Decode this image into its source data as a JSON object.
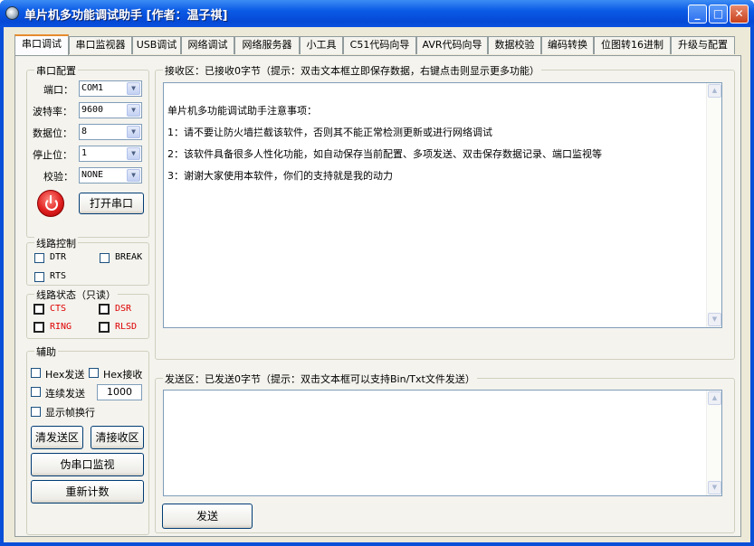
{
  "window": {
    "title": "单片机多功能调试助手 [作者：温子祺]",
    "minimize_icon": "minimize-icon",
    "maximize_icon": "maximize-icon",
    "close_icon": "close-icon"
  },
  "tabs": [
    {
      "label": "串口调试",
      "active": true
    },
    {
      "label": "串口监视器"
    },
    {
      "label": "USB调试"
    },
    {
      "label": "网络调试"
    },
    {
      "label": "网络服务器"
    },
    {
      "label": "小工具"
    },
    {
      "label": "C51代码向导"
    },
    {
      "label": "AVR代码向导"
    },
    {
      "label": "数据校验"
    },
    {
      "label": "编码转换"
    },
    {
      "label": "位图转16进制"
    },
    {
      "label": "升级与配置"
    }
  ],
  "serial_config": {
    "title": "串口配置",
    "port_label": "端口：",
    "port_value": "COM1",
    "baud_label": "波特率：",
    "baud_value": "9600",
    "databits_label": "数据位：",
    "databits_value": "8",
    "stopbits_label": "停止位：",
    "stopbits_value": "1",
    "parity_label": "校验：",
    "parity_value": "NONE",
    "open_button": "打开串口",
    "power_icon": "power-icon"
  },
  "line_control": {
    "title": "线路控制",
    "dtr": "DTR",
    "break": "BREAK",
    "rts": "RTS"
  },
  "line_status": {
    "title": "线路状态（只读）",
    "cts": "CTS",
    "dsr": "DSR",
    "ring": "RING",
    "rlsd": "RLSD",
    "status_color": "#dd0000"
  },
  "aux": {
    "title": "辅助",
    "hex_send": "Hex发送",
    "hex_recv": "Hex接收",
    "continuous_send": "连续发送",
    "interval_value": "1000",
    "show_frame_newline": "显示帧换行",
    "clear_send": "清发送区",
    "clear_recv": "清接收区",
    "fake_monitor": "伪串口监视",
    "recount": "重新计数"
  },
  "receive": {
    "title": "接收区：已接收0字节（提示：双击文本框立即保存数据，右键点击则显示更多功能）",
    "lines": [
      "单片机多功能调试助手注意事项：",
      "1：请不要让防火墙拦截该软件，否则其不能正常检测更新或进行网络调试",
      "2：该软件具备很多人性化功能，如自动保存当前配置、多项发送、双击保存数据记录、端口监视等",
      "3：谢谢大家使用本软件，你们的支持就是我的动力"
    ]
  },
  "send": {
    "title": "发送区：已发送0字节（提示：双击文本框可以支持Bin/Txt文件发送）",
    "button": "发送"
  }
}
